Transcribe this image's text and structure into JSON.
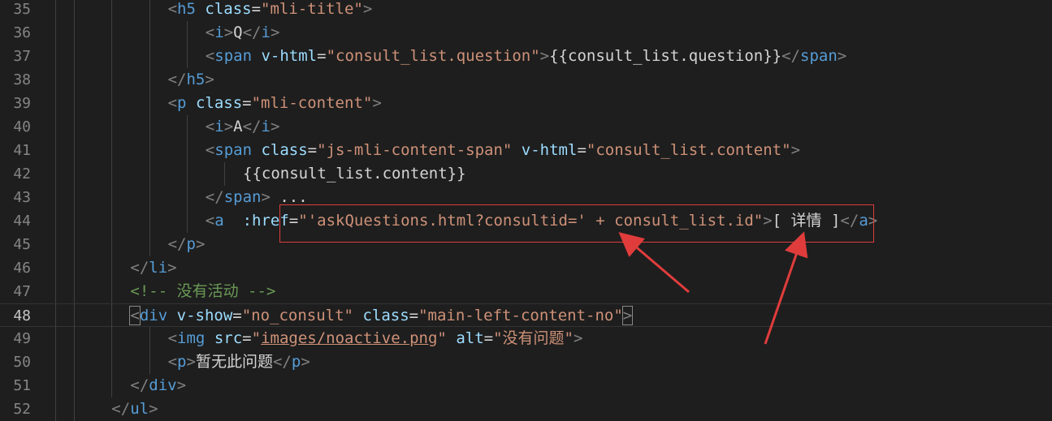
{
  "editor": {
    "current_line": "48",
    "lines": [
      {
        "no": "35",
        "indent": 12,
        "tokens": [
          [
            "t-punc",
            "<"
          ],
          [
            "t-tag",
            "h5"
          ],
          [
            "t-text",
            " "
          ],
          [
            "t-attr",
            "class"
          ],
          [
            "t-text",
            "="
          ],
          [
            "t-str",
            "\"mli-title\""
          ],
          [
            "t-punc",
            ">"
          ]
        ]
      },
      {
        "no": "36",
        "indent": 16,
        "tokens": [
          [
            "t-punc",
            "<"
          ],
          [
            "t-tag",
            "i"
          ],
          [
            "t-punc",
            ">"
          ],
          [
            "t-text",
            "Q"
          ],
          [
            "t-punc",
            "</"
          ],
          [
            "t-tag",
            "i"
          ],
          [
            "t-punc",
            ">"
          ]
        ]
      },
      {
        "no": "37",
        "indent": 16,
        "tokens": [
          [
            "t-punc",
            "<"
          ],
          [
            "t-tag",
            "span"
          ],
          [
            "t-text",
            " "
          ],
          [
            "t-attr",
            "v-html"
          ],
          [
            "t-text",
            "="
          ],
          [
            "t-str",
            "\"consult_list.question\""
          ],
          [
            "t-punc",
            ">"
          ],
          [
            "t-text",
            "{{consult_list.question}}"
          ],
          [
            "t-punc",
            "</"
          ],
          [
            "t-tag",
            "span"
          ],
          [
            "t-punc",
            ">"
          ]
        ]
      },
      {
        "no": "38",
        "indent": 12,
        "tokens": [
          [
            "t-punc",
            "</"
          ],
          [
            "t-tag",
            "h5"
          ],
          [
            "t-punc",
            ">"
          ]
        ]
      },
      {
        "no": "39",
        "indent": 12,
        "tokens": [
          [
            "t-punc",
            "<"
          ],
          [
            "t-tag",
            "p"
          ],
          [
            "t-text",
            " "
          ],
          [
            "t-attr",
            "class"
          ],
          [
            "t-text",
            "="
          ],
          [
            "t-str",
            "\"mli-content\""
          ],
          [
            "t-punc",
            ">"
          ]
        ]
      },
      {
        "no": "40",
        "indent": 16,
        "tokens": [
          [
            "t-punc",
            "<"
          ],
          [
            "t-tag",
            "i"
          ],
          [
            "t-punc",
            ">"
          ],
          [
            "t-text",
            "A"
          ],
          [
            "t-punc",
            "</"
          ],
          [
            "t-tag",
            "i"
          ],
          [
            "t-punc",
            ">"
          ]
        ]
      },
      {
        "no": "41",
        "indent": 16,
        "tokens": [
          [
            "t-punc",
            "<"
          ],
          [
            "t-tag",
            "span"
          ],
          [
            "t-text",
            " "
          ],
          [
            "t-attr",
            "class"
          ],
          [
            "t-text",
            "="
          ],
          [
            "t-str",
            "\"js-mli-content-span\""
          ],
          [
            "t-text",
            " "
          ],
          [
            "t-attr",
            "v-html"
          ],
          [
            "t-text",
            "="
          ],
          [
            "t-str",
            "\"consult_list.content\""
          ],
          [
            "t-punc",
            ">"
          ]
        ]
      },
      {
        "no": "42",
        "indent": 20,
        "tokens": [
          [
            "t-text",
            "{{consult_list.content}}"
          ]
        ]
      },
      {
        "no": "43",
        "indent": 16,
        "tokens": [
          [
            "t-punc",
            "</"
          ],
          [
            "t-tag",
            "span"
          ],
          [
            "t-punc",
            ">"
          ],
          [
            "t-text",
            " ..."
          ]
        ]
      },
      {
        "no": "44",
        "indent": 16,
        "tokens": [
          [
            "t-punc",
            "<"
          ],
          [
            "t-tag",
            "a"
          ],
          [
            "t-text",
            "  "
          ],
          [
            "t-attr",
            ":href"
          ],
          [
            "t-text",
            "="
          ],
          [
            "t-str",
            "\"'askQuestions.html?consultid=' + consult_list.id\""
          ],
          [
            "t-punc",
            ">"
          ],
          [
            "t-text",
            "[ 详情 ]"
          ],
          [
            "t-punc",
            "</"
          ],
          [
            "t-tag",
            "a"
          ],
          [
            "t-punc",
            ">"
          ]
        ]
      },
      {
        "no": "45",
        "indent": 12,
        "tokens": [
          [
            "t-punc",
            "</"
          ],
          [
            "t-tag",
            "p"
          ],
          [
            "t-punc",
            ">"
          ]
        ]
      },
      {
        "no": "46",
        "indent": 8,
        "tokens": [
          [
            "t-punc",
            "</"
          ],
          [
            "t-tag",
            "li"
          ],
          [
            "t-punc",
            ">"
          ]
        ]
      },
      {
        "no": "47",
        "indent": 8,
        "tokens": [
          [
            "t-com",
            "<!-- 没有活动 -->"
          ]
        ]
      },
      {
        "no": "48",
        "indent": 8,
        "tokens": [
          [
            "t-punc bracket-box",
            "<"
          ],
          [
            "t-tag",
            "div"
          ],
          [
            "t-text",
            " "
          ],
          [
            "t-attr",
            "v-show"
          ],
          [
            "t-text",
            "="
          ],
          [
            "t-str",
            "\"no_consult\""
          ],
          [
            "t-text",
            " "
          ],
          [
            "t-attr",
            "class"
          ],
          [
            "t-text",
            "="
          ],
          [
            "t-str",
            "\"main-left-content-no\""
          ],
          [
            "t-punc bracket-box",
            ">"
          ]
        ]
      },
      {
        "no": "49",
        "indent": 12,
        "tokens": [
          [
            "t-punc",
            "<"
          ],
          [
            "t-tag",
            "img"
          ],
          [
            "t-text",
            " "
          ],
          [
            "t-attr",
            "src"
          ],
          [
            "t-text",
            "="
          ],
          [
            "t-str",
            "\""
          ],
          [
            "t-link",
            "images/noactive.png"
          ],
          [
            "t-str",
            "\""
          ],
          [
            "t-text",
            " "
          ],
          [
            "t-attr",
            "alt"
          ],
          [
            "t-text",
            "="
          ],
          [
            "t-str",
            "\"没有问题\""
          ],
          [
            "t-punc",
            ">"
          ]
        ]
      },
      {
        "no": "50",
        "indent": 12,
        "tokens": [
          [
            "t-punc",
            "<"
          ],
          [
            "t-tag",
            "p"
          ],
          [
            "t-punc",
            ">"
          ],
          [
            "t-text",
            "暂无此问题"
          ],
          [
            "t-punc",
            "</"
          ],
          [
            "t-tag",
            "p"
          ],
          [
            "t-punc",
            ">"
          ]
        ]
      },
      {
        "no": "51",
        "indent": 8,
        "tokens": [
          [
            "t-punc",
            "</"
          ],
          [
            "t-tag",
            "div"
          ],
          [
            "t-punc",
            ">"
          ]
        ]
      },
      {
        "no": "52",
        "indent": 6,
        "tokens": [
          [
            "t-punc",
            "</"
          ],
          [
            "t-tag",
            "ul"
          ],
          [
            "t-punc",
            ">"
          ]
        ]
      }
    ]
  },
  "colors": {
    "background": "#1e1e1e",
    "tag": "#569cd6",
    "attribute": "#9cdcfe",
    "string": "#ce9178",
    "comment": "#6a9955",
    "annotation": "#e03c3c"
  }
}
